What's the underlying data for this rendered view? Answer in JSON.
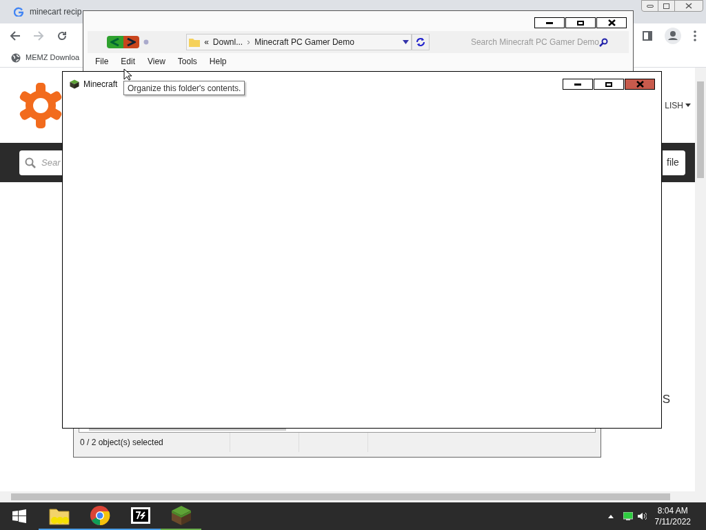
{
  "browser": {
    "tabs": [
      {
        "title": "minecart recip",
        "selected": false
      }
    ],
    "bookmarks": [
      {
        "label": "MEMZ Downloa"
      }
    ],
    "page": {
      "language": "LISH",
      "search_placeholder": "Sear",
      "button": "file",
      "heading_fragment": "S"
    }
  },
  "explorer": {
    "breadcrumb": [
      "«",
      "Downl...",
      "Minecraft PC Gamer Demo"
    ],
    "search_placeholder": "Search Minecraft PC Gamer Demo",
    "menu": [
      "File",
      "Edit",
      "View",
      "Tools",
      "Help"
    ]
  },
  "explorer_lower": {
    "status": "0 / 2 object(s) selected"
  },
  "game_window": {
    "title": "Minecraft"
  },
  "tooltip": "Organize this folder's contents.",
  "taskbar": {
    "apps": [
      {
        "kind": "folder"
      },
      {
        "kind": "browser"
      },
      {
        "kind": "archiver"
      },
      {
        "kind": "game"
      }
    ],
    "time": "8:04 AM",
    "date": "7/11/2022"
  }
}
